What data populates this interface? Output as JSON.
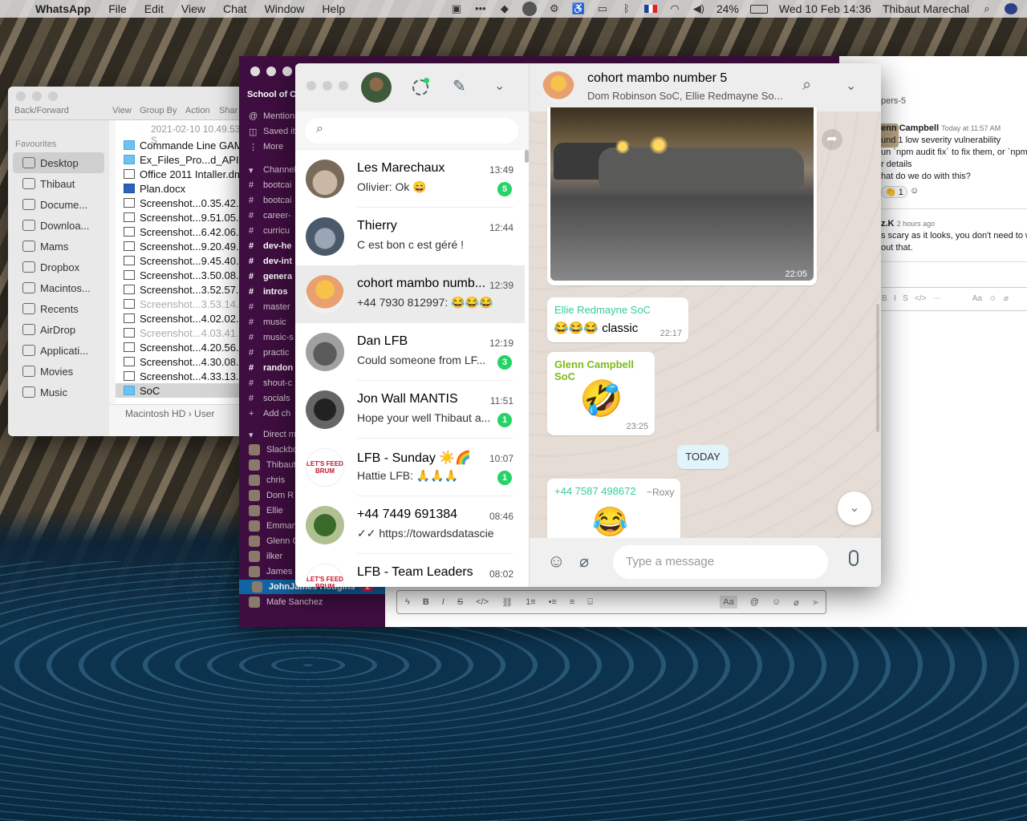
{
  "menubar": {
    "apple": "",
    "app": "WhatsApp",
    "items": [
      "File",
      "Edit",
      "View",
      "Chat",
      "Window",
      "Help"
    ],
    "battery": "24%",
    "datetime": "Wed 10 Feb  14:36",
    "user": "Thibaut Marechal"
  },
  "finder": {
    "toolbar": {
      "back": "Back/Forward",
      "view": "View",
      "group": "Group By",
      "action": "Action",
      "share": "Shar"
    },
    "path_top": "2021-02-10 10.49.53 S",
    "favourites_label": "Favourites",
    "sidebar": [
      "Desktop",
      "Thibaut",
      "Docume...",
      "Downloa...",
      "Mams",
      "Dropbox",
      "Macintos...",
      "Recents",
      "AirDrop",
      "Applicati...",
      "Movies",
      "Music"
    ],
    "files": [
      {
        "name": "Commande Line GAME",
        "kind": "folder",
        "dim": false
      },
      {
        "name": "Ex_Files_Pro...d_APIs_We",
        "kind": "folder",
        "dim": false
      },
      {
        "name": "Office 2011 Intaller.dmg",
        "kind": "file",
        "dim": false
      },
      {
        "name": "Plan.docx",
        "kind": "doc",
        "dim": false
      },
      {
        "name": "Screenshot...0.35.42.pn",
        "kind": "file",
        "dim": false
      },
      {
        "name": "Screenshot...9.51.05.pn",
        "kind": "file",
        "dim": false
      },
      {
        "name": "Screenshot...6.42.06.pn",
        "kind": "file",
        "dim": false
      },
      {
        "name": "Screenshot...9.20.49.pn",
        "kind": "file",
        "dim": false
      },
      {
        "name": "Screenshot...9.45.40.pn",
        "kind": "file",
        "dim": false
      },
      {
        "name": "Screenshot...3.50.08.pn",
        "kind": "file",
        "dim": false
      },
      {
        "name": "Screenshot...3.52.57.pn",
        "kind": "file",
        "dim": false
      },
      {
        "name": "Screenshot...3.53.14.pn",
        "kind": "file",
        "dim": true
      },
      {
        "name": "Screenshot...4.02.02.pn",
        "kind": "file",
        "dim": false
      },
      {
        "name": "Screenshot...4.03.41.pn",
        "kind": "file",
        "dim": true
      },
      {
        "name": "Screenshot...4.20.56.pn",
        "kind": "file",
        "dim": false
      },
      {
        "name": "Screenshot...4.30.08.pn",
        "kind": "file",
        "dim": false
      },
      {
        "name": "Screenshot...4.33.13.pn",
        "kind": "file",
        "dim": false
      },
      {
        "name": "SoC",
        "kind": "folder",
        "dim": false
      }
    ],
    "pathbar": "Macintosh HD  ›  User"
  },
  "slack": {
    "workspace": "School of Co",
    "top_items": [
      "Mentions",
      "Saved ite",
      "More"
    ],
    "channels_label": "Channels",
    "channels": [
      {
        "name": "bootcai",
        "bold": false
      },
      {
        "name": "bootcai",
        "bold": false
      },
      {
        "name": "career-",
        "bold": false
      },
      {
        "name": "curricu",
        "bold": false
      },
      {
        "name": "dev-he",
        "bold": true
      },
      {
        "name": "dev-int",
        "bold": true
      },
      {
        "name": "genera",
        "bold": true
      },
      {
        "name": "intros",
        "bold": true
      },
      {
        "name": "master",
        "bold": false
      },
      {
        "name": "music",
        "bold": false
      },
      {
        "name": "music-s",
        "bold": false
      },
      {
        "name": "practic",
        "bold": false
      },
      {
        "name": "randon",
        "bold": true
      },
      {
        "name": "shout-c",
        "bold": false
      },
      {
        "name": "socials",
        "bold": false
      },
      {
        "name": "Add ch",
        "bold": false
      }
    ],
    "dm_label": "Direct me",
    "dms": [
      "Slackbo",
      "Thibaut",
      "chris",
      "Dom R",
      "Ellie",
      "Emman",
      "Glenn C",
      "ilker",
      "James"
    ],
    "active_dm": "JohnJames Hodgins",
    "active_badge": "2",
    "last_dm": "Mafe Sanchez",
    "thread_label": "pers-5",
    "msg1_author": "enn Campbell",
    "msg1_time": "Today at 11:57 AM",
    "msg1_lines": [
      "und 1 low severity vulnerability",
      "un `npm audit fix` to fix them, or `npm a",
      "r details",
      "hat do we do with this?"
    ],
    "reaction_count": "1",
    "msg2_author": "z.K",
    "msg2_time": "2 hours ago",
    "msg2_lines": [
      "s scary as it looks, you don't need to wor",
      "out that."
    ],
    "composer_aa": "Aa"
  },
  "whatsapp": {
    "search_placeholder": "",
    "chats": [
      {
        "name": "Les Marechaux",
        "time": "13:49",
        "preview": "Olivier: Ok 😄",
        "count": "5",
        "selected": false
      },
      {
        "name": "Thierry",
        "time": "12:44",
        "preview": "C est bon c est géré !",
        "count": "",
        "selected": false
      },
      {
        "name": "cohort mambo numb...",
        "time": "12:39",
        "preview": "+44 7930 812997: 😂😂😂",
        "count": "",
        "selected": true
      },
      {
        "name": "Dan LFB",
        "time": "12:19",
        "preview": "Could someone from LF...",
        "count": "3",
        "selected": false
      },
      {
        "name": "Jon Wall MANTIS",
        "time": "11:51",
        "preview": "Hope your well Thibaut a...",
        "count": "1",
        "selected": false
      },
      {
        "name": "LFB - Sunday ☀️🌈",
        "time": "10:07",
        "preview": "Hattie LFB: 🙏🙏🙏",
        "count": "1",
        "selected": false
      },
      {
        "name": "+44 7449 691384",
        "time": "08:46",
        "preview": "✓✓ https://towardsdatascien...",
        "count": "",
        "selected": false
      },
      {
        "name": "LFB - Team Leaders",
        "time": "08:02",
        "preview": "",
        "count": "",
        "selected": false
      }
    ],
    "lfb_logo_text": "LET'S FEED\nBRUM",
    "conversation": {
      "title": "cohort mambo number 5",
      "subtitle": "Dom Robinson SoC, Ellie Redmayne So...",
      "image_time": "22:05",
      "messages": [
        {
          "sender": "Ellie Redmayne SoC",
          "sender_color": "#35cd96",
          "text": "😂😂😂 classic",
          "time": "22:17"
        },
        {
          "sender": "Glenn Campbell SoC",
          "sender_color": "#7bbb1a",
          "emoji": "🤣",
          "time": "23:25"
        },
        {
          "sender": "+44 7587 498672",
          "sender_color": "#35cd96",
          "alias": "~Roxy",
          "emoji": "😂"
        }
      ],
      "date_chip": "TODAY",
      "input_placeholder": "Type a message"
    }
  }
}
